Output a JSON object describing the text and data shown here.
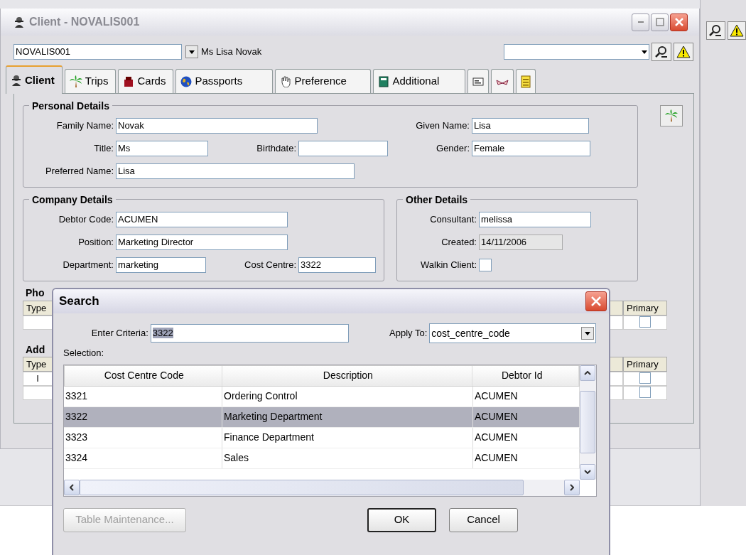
{
  "window": {
    "title": "Client - NOVALIS001"
  },
  "header": {
    "client_code": "NOVALIS001",
    "client_name": "Ms Lisa Novak"
  },
  "tabs": [
    {
      "kind": "text",
      "label": "Client",
      "selected": true
    },
    {
      "kind": "text",
      "label": "Trips",
      "selected": false
    },
    {
      "kind": "text",
      "label": "Cards",
      "selected": false
    },
    {
      "kind": "text",
      "label": "Passports",
      "selected": false
    },
    {
      "kind": "text",
      "label": "Preference",
      "selected": false
    },
    {
      "kind": "text",
      "label": "Additional",
      "selected": false
    },
    {
      "kind": "icon",
      "selected": false
    },
    {
      "kind": "icon",
      "selected": false
    },
    {
      "kind": "icon",
      "selected": false
    }
  ],
  "personal_details": {
    "title": "Personal Details",
    "rows": [
      [
        {
          "label": "Family Name:",
          "value": "Novak"
        },
        null,
        {
          "label": "Given Name:",
          "value": "Lisa"
        }
      ],
      [
        {
          "label": "Title:",
          "value": "Ms"
        },
        {
          "label": "Birthdate:"
        },
        {
          "label": "Gender:",
          "value": "Female"
        }
      ],
      [
        {
          "label": "Preferred Name:",
          "value": "Lisa"
        }
      ]
    ]
  },
  "company_details": {
    "title": "Company Details",
    "rows": [
      [
        {
          "label": "Debtor Code:",
          "value": "ACUMEN"
        }
      ],
      [
        {
          "label": "Position:",
          "value": "Marketing Director"
        }
      ],
      [
        {
          "label": "Department:",
          "value": "marketing"
        },
        {
          "label": "Cost Centre:",
          "value": "3322"
        }
      ]
    ]
  },
  "other_details": {
    "title": "Other Details",
    "rows": [
      [
        {
          "kind": "text",
          "label": "Consultant:",
          "value": "melissa",
          "readonly": false
        }
      ],
      [
        {
          "kind": "text",
          "label": "Created:",
          "value": "14/11/2006",
          "readonly": true
        }
      ],
      [
        {
          "kind": "checkbox",
          "label": "Walkin Client:",
          "checked": false
        }
      ]
    ]
  },
  "phone": {
    "title": "Pho",
    "columns": [
      "Type",
      "Primary"
    ],
    "rows": [
      {
        "primary": false
      }
    ]
  },
  "address": {
    "title": "Add",
    "columns": [
      "Type",
      "Primary"
    ],
    "rows": [
      {
        "type": "I",
        "primary": false
      },
      {
        "primary": false
      }
    ]
  },
  "search_dialog": {
    "title": "Search",
    "criteria_label": "Enter Criteria:",
    "criteria_value": "3322",
    "criteria_selected": true,
    "apply_label": "Apply To:",
    "apply_value": "cost_centre_code",
    "selection_label": "Selection:",
    "table": {
      "columns": [
        "Cost Centre Code",
        "Description",
        "Debtor Id"
      ],
      "rows": [
        {
          "cells": [
            "3321",
            "Ordering Control",
            "ACUMEN"
          ],
          "selected": false
        },
        {
          "cells": [
            "3322",
            "Marketing Department",
            "ACUMEN"
          ],
          "selected": true
        },
        {
          "cells": [
            "3323",
            "Finance Department",
            "ACUMEN"
          ],
          "selected": false
        },
        {
          "cells": [
            "3324",
            "Sales",
            "ACUMEN"
          ],
          "selected": false
        }
      ]
    },
    "buttons": [
      {
        "label": "Table Maintenance...",
        "disabled": true,
        "default": false
      },
      {
        "label": "OK",
        "disabled": false,
        "default": true
      },
      {
        "label": "Cancel",
        "disabled": false,
        "default": false
      }
    ]
  }
}
